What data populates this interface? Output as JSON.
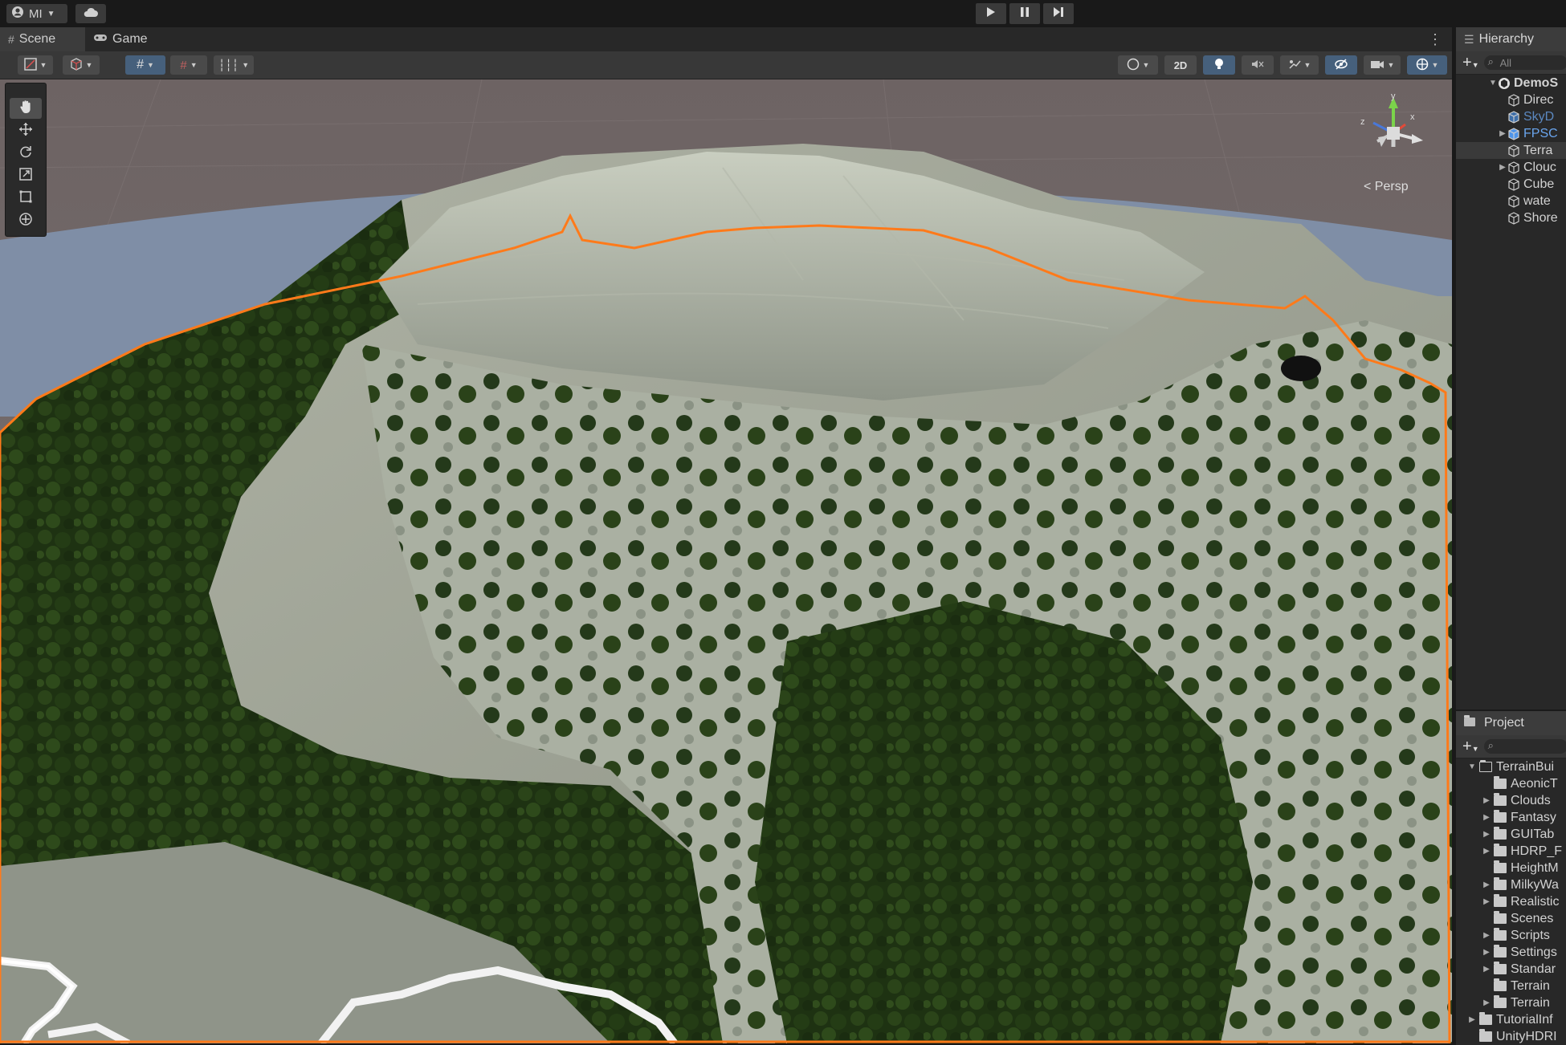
{
  "toolbar": {
    "account_label": "MI",
    "play_icons": [
      "play-icon",
      "pause-icon",
      "step-icon"
    ]
  },
  "scene_tabs": [
    {
      "label": "Scene",
      "icon": "grid-icon",
      "active": true
    },
    {
      "label": "Game",
      "icon": "gamepad-icon",
      "active": false
    }
  ],
  "scene_toolbar": {
    "mode_2d_label": "2D"
  },
  "viewport": {
    "projection_label": "< Persp",
    "gizmo_axes": {
      "x": "x",
      "y": "y",
      "z": "z"
    },
    "colors": {
      "selection_outline": "#ff7a1a",
      "sky": "#6f6767",
      "water": "#7d8fa8",
      "forest": "#213714",
      "terrain": "#a5a99a"
    }
  },
  "hierarchy": {
    "title": "Hierarchy",
    "search_placeholder": "All",
    "items": [
      {
        "label": "DemoS",
        "depth": 0,
        "expand": "open",
        "icon": "unity-scene-icon",
        "bold": true
      },
      {
        "label": "Direc",
        "depth": 1,
        "expand": "",
        "icon": "gameobject-icon"
      },
      {
        "label": "SkyD",
        "depth": 1,
        "expand": "",
        "icon": "prefab-icon",
        "style": "prefab-dim"
      },
      {
        "label": "FPSC",
        "depth": 1,
        "expand": "closed",
        "icon": "prefab-icon",
        "style": "prefab"
      },
      {
        "label": "Terra",
        "depth": 1,
        "expand": "",
        "icon": "gameobject-icon",
        "selected": true
      },
      {
        "label": "Clouc",
        "depth": 1,
        "expand": "closed",
        "icon": "gameobject-icon"
      },
      {
        "label": "Cube",
        "depth": 1,
        "expand": "",
        "icon": "gameobject-icon"
      },
      {
        "label": "wate",
        "depth": 1,
        "expand": "",
        "icon": "gameobject-icon"
      },
      {
        "label": "Shore",
        "depth": 1,
        "expand": "",
        "icon": "gameobject-icon"
      }
    ]
  },
  "project": {
    "title": "Project",
    "search_placeholder": "",
    "items": [
      {
        "label": "TerrainBui",
        "depth": 0,
        "expand": "open",
        "open": true
      },
      {
        "label": "AeonicT",
        "depth": 1,
        "expand": ""
      },
      {
        "label": "Clouds",
        "depth": 1,
        "expand": "closed"
      },
      {
        "label": "Fantasy",
        "depth": 1,
        "expand": "closed"
      },
      {
        "label": "GUITab",
        "depth": 1,
        "expand": "closed"
      },
      {
        "label": "HDRP_F",
        "depth": 1,
        "expand": "closed"
      },
      {
        "label": "HeightM",
        "depth": 1,
        "expand": ""
      },
      {
        "label": "MilkyWa",
        "depth": 1,
        "expand": "closed"
      },
      {
        "label": "Realistic",
        "depth": 1,
        "expand": "closed"
      },
      {
        "label": "Scenes",
        "depth": 1,
        "expand": ""
      },
      {
        "label": "Scripts",
        "depth": 1,
        "expand": "closed"
      },
      {
        "label": "Settings",
        "depth": 1,
        "expand": "closed"
      },
      {
        "label": "Standar",
        "depth": 1,
        "expand": "closed"
      },
      {
        "label": "Terrain",
        "depth": 1,
        "expand": ""
      },
      {
        "label": "Terrain",
        "depth": 1,
        "expand": "closed"
      },
      {
        "label": "TutorialInf",
        "depth": 0,
        "expand": "closed"
      },
      {
        "label": "UnityHDRI",
        "depth": 0,
        "expand": ""
      }
    ]
  }
}
